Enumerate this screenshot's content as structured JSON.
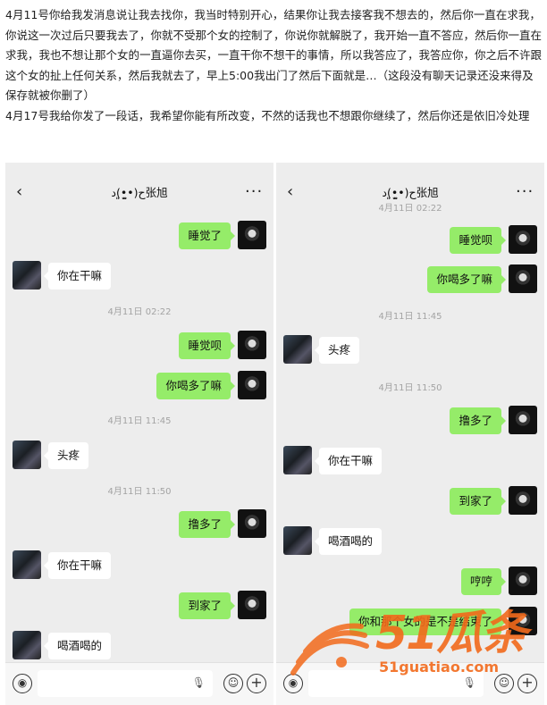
{
  "article": {
    "paragraph1": "4月11号你给我发消息说让我去找你，我当时特别开心，结果你让我去接客我不想去的，然后你一直在求我，你说这一次过后只要我去了，你就不受那个女的控制了，你说你就解脱了，我开始一直不答应，然后你一直在求我，我也不想让那个女的一直逼你去买，一直干你不想干的事情，所以我答应了，我答应你，你之后不许跟这个女的扯上任何关系，然后我就去了，早上5:00我出门了然后下面就是…（这段没有聊天记录还没来得及保存就被你删了）",
    "paragraph2": "4月17号我给你发了一段话，我希望你能有所改变，不然的话我也不想跟你继续了，然后你还是依旧冷处理"
  },
  "chat_left": {
    "title": "ح(•͈̫•͈)د张旭",
    "messages": [
      {
        "side": "me",
        "text": "睡觉了"
      },
      {
        "side": "other",
        "text": "你在干嘛"
      },
      {
        "side": "time",
        "text": "4月11日 02:22"
      },
      {
        "side": "me",
        "text": "睡觉呗"
      },
      {
        "side": "me",
        "text": "你喝多了嘛"
      },
      {
        "side": "time",
        "text": "4月11日 11:45"
      },
      {
        "side": "other",
        "text": "头疼"
      },
      {
        "side": "time",
        "text": "4月11日 11:50"
      },
      {
        "side": "me",
        "text": "撸多了"
      },
      {
        "side": "other",
        "text": "你在干嘛"
      },
      {
        "side": "me",
        "text": "到家了"
      },
      {
        "side": "other",
        "text": "喝酒喝的"
      }
    ]
  },
  "chat_right": {
    "title": "ح(•͈̫•͈)د张旭",
    "top_time": "4月11日 02:22",
    "messages": [
      {
        "side": "me",
        "text": "睡觉呗"
      },
      {
        "side": "me",
        "text": "你喝多了嘛"
      },
      {
        "side": "time",
        "text": "4月11日 11:45"
      },
      {
        "side": "other",
        "text": "头疼"
      },
      {
        "side": "time",
        "text": "4月11日 11:50"
      },
      {
        "side": "me",
        "text": "撸多了"
      },
      {
        "side": "other",
        "text": "你在干嘛"
      },
      {
        "side": "me",
        "text": "到家了"
      },
      {
        "side": "other",
        "text": "喝酒喝的"
      },
      {
        "side": "me",
        "text": "哼哼"
      },
      {
        "side": "me",
        "text": "你和那个女的是不是结束了"
      }
    ]
  },
  "watermark": {
    "brand": "51瓜条",
    "url": "51guatiao.com"
  },
  "colors": {
    "my_bubble": "#95ec69",
    "other_bubble": "#ffffff",
    "chat_bg": "#ededed",
    "watermark": "#f26a1b"
  },
  "icons": [
    "back-icon",
    "more-icon",
    "voice-icon",
    "mic-icon",
    "emoji-icon",
    "plus-icon"
  ]
}
